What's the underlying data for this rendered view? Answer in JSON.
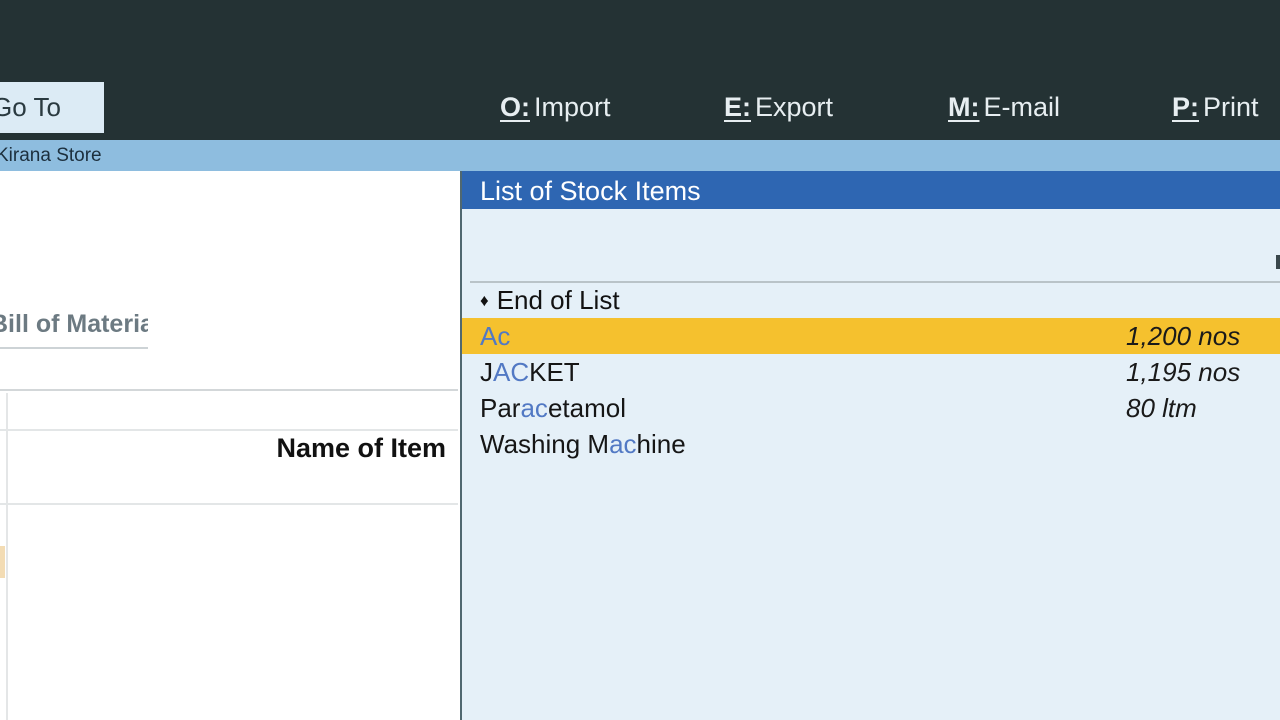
{
  "toolbar": {
    "goto_label": "Go To",
    "menu": [
      {
        "key": "O:",
        "label": "Import"
      },
      {
        "key": "E:",
        "label": "Export"
      },
      {
        "key": "M:",
        "label": "E-mail"
      },
      {
        "key": "P:",
        "label": "Print"
      }
    ]
  },
  "company": {
    "name": "Kirana Store"
  },
  "left_panel": {
    "heading": "Bill of Materials",
    "column_header": "Name of Item"
  },
  "stock_list": {
    "title": "List of Stock Items",
    "end_of_list": "End of List",
    "typed_filter": "ac",
    "items": [
      {
        "name_parts": [
          "A",
          "c",
          ""
        ],
        "quantity": "1,200 nos",
        "selected": true
      },
      {
        "name_parts": [
          "J",
          "AC",
          "KET"
        ],
        "quantity": "1,195 nos",
        "selected": false
      },
      {
        "name_parts": [
          "Par",
          "ac",
          "etamol"
        ],
        "quantity": "80 ltm",
        "selected": false
      },
      {
        "name_parts": [
          "Washing M",
          "ac",
          "hine"
        ],
        "quantity": "",
        "selected": false
      }
    ]
  },
  "colors": {
    "topbar": "#243234",
    "company_strip": "#8ebddf",
    "list_title": "#2e66b2",
    "list_bg": "#e5f0f8",
    "selected_row": "#f5c12e",
    "match_highlight": "#5279c4"
  }
}
